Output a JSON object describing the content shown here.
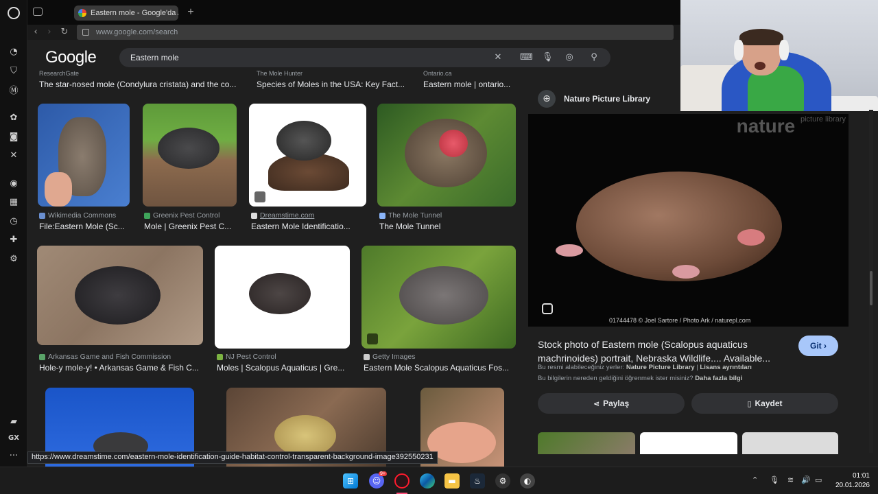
{
  "browser": {
    "tab_title": "Eastern mole - Google'da A",
    "new_tab": "+",
    "url": "www.google.com/search",
    "sidebar_gx": "GX",
    "sidebar_more": "···"
  },
  "google": {
    "logo": "Google",
    "query": "Eastern mole"
  },
  "top_row": [
    {
      "source": "ResearchGate",
      "title": "The star-nosed mole (Condylura cristata) and the co..."
    },
    {
      "source": "The Mole Hunter",
      "title": "Species of Moles in the USA: Key Fact..."
    },
    {
      "source": "Ontario.ca",
      "title": "Eastern mole | ontario..."
    }
  ],
  "row1": [
    {
      "source": "Wikimedia Commons",
      "title": "File:Eastern Mole (Sc...",
      "icon_color": "#6a8fd0"
    },
    {
      "source": "Greenix Pest Control",
      "title": "Mole | Greenix Pest C...",
      "icon_color": "#3fa55b"
    },
    {
      "source": "Dreamstime.com",
      "title": "Eastern Mole Identificatio...",
      "icon_color": "#dddddd"
    },
    {
      "source": "The Mole Tunnel",
      "title": "The Mole Tunnel",
      "icon_color": "#8ab4f8"
    }
  ],
  "row2": [
    {
      "source": "Arkansas Game and Fish Commission",
      "title": "Hole-y mole-y! • Arkansas Game & Fish C...",
      "icon_color": "#5aa469"
    },
    {
      "source": "NJ Pest Control",
      "title": "Moles | Scalopus Aquaticus | Gre...",
      "icon_color": "#7cb342"
    },
    {
      "source": "Getty Images",
      "title": "Eastern Mole Scalopus Aquaticus Fos...",
      "icon_color": "#cccccc"
    }
  ],
  "panel": {
    "site": "Nature Picture Library",
    "watermark": "nature",
    "watermark_small": "picture library",
    "credit": "01744478 © Joel Sartore / Photo Ark / naturepl.com",
    "title": "Stock photo of Eastern mole (Scalopus aquaticus machrinoides) portrait, Nebraska Wildlife.... Available...",
    "visit_label": "Git",
    "line1_prefix": "Bu resmi alabileceğiniz yerler:",
    "line1_site": "Nature Picture Library",
    "line1_sep": "|",
    "line1_license": "Lisans ayrıntıları",
    "line2_text": "Bu bilgilerin nereden geldiğini öğrenmek ister misiniz?",
    "line2_link": "Daha fazla bilgi",
    "share_label": "Paylaş",
    "save_label": "Kaydet"
  },
  "status_url": "https://www.dreamstime.com/eastern-mole-identification-guide-habitat-control-transparent-background-image392550231",
  "taskbar": {
    "discord_badge": "9+",
    "time": "01:01",
    "date": "20.01.2026"
  },
  "colors": {
    "background": "#1f1f1f",
    "accent_button": "#a8c7fa",
    "text": "#e8eaed",
    "muted": "#9aa0a6"
  }
}
